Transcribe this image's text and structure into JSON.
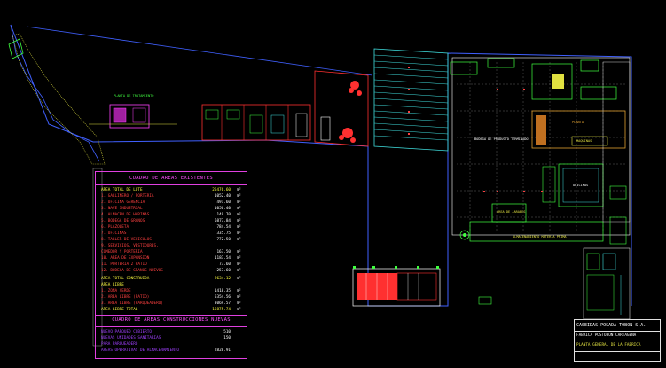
{
  "colors": {
    "background": "#000000",
    "table_border": "#e040e0",
    "table_title": "#ff50ff",
    "table_text": "#ff4040",
    "table_value": "#ffffff",
    "highlight": "#ffff40",
    "new_text": "#a040ff",
    "site_outline": "#4060ff",
    "parking_hatch": "#40e0e0",
    "walls": "#ff3030",
    "equipment": "#40ff40",
    "title_block": "#e0e0e0"
  },
  "existing_table": {
    "title": "CUADRO DE AREAS EXISTENTES",
    "total_label": "AREA TOTAL DE LOTE",
    "total_value": "25476.60",
    "unit": "m²",
    "rows": [
      {
        "label": "1.  GALLINERO / PORTERIA",
        "value": "1052.40"
      },
      {
        "label": "2.  OFICINA GERENCIA",
        "value": "491.60"
      },
      {
        "label": "3.  NAVE INDUSTRIAL",
        "value": "1056.40"
      },
      {
        "label": "4.  ALMACEN DE HARINAS",
        "value": "149.70"
      },
      {
        "label": "5.  BODEGA DE GRANOS",
        "value": "6877.84"
      },
      {
        "label": "6.  PLAZOLETA",
        "value": "784.54"
      },
      {
        "label": "7.  OFICINAS",
        "value": "335.75"
      },
      {
        "label": "8.  TALLER DE VEHICULOS",
        "value": "772.50"
      },
      {
        "label": "9.  SERVICIOS, VESTIDORES,",
        "value": ""
      },
      {
        "label": "    COMEDOR Y PORTERIA",
        "value": "163.50"
      },
      {
        "label": "10. AREA DE EXPANSION",
        "value": "1183.54"
      },
      {
        "label": "11. PORTERIA 2 PATIO",
        "value": "73.60"
      },
      {
        "label": "12. BODEGA DE GRANOS NUEVOS",
        "value": "257.60"
      }
    ],
    "built_label": "AREA TOTAL CONSTRUIDA",
    "built_value": "9634.12",
    "free_header": "AREA  LIBRE",
    "free_rows": [
      {
        "label": "1.  ZONA VERDE",
        "value": "1418.35"
      },
      {
        "label": "2.  AREA LIBRE (PATIO)",
        "value": "5354.56"
      },
      {
        "label": "3.  AREA LIBRE (PARQUEADERO)",
        "value": "3069.57"
      }
    ],
    "free_total_label": "AREA LIBRE TOTAL",
    "free_total_value": "15875.74"
  },
  "new_table": {
    "title": "CUADRO DE AREAS CONSTRUCCIONES NUEVAS",
    "rows": [
      {
        "label": "NUEVO PARQUEO CUBIERTO",
        "value": "510"
      },
      {
        "label": "NUEVAS UNIDADES SANITARIAS",
        "value": "150"
      },
      {
        "label": "PARA PARQUEADERO",
        "value": ""
      },
      {
        "label": "AREAS OPERATIVAS DE ALMACENAMIENTO",
        "value": "2828.91"
      }
    ]
  },
  "title_block": {
    "company": "CASEIDAS POSADA TOBON S.A.",
    "project": "FABRICA POSTOBON CARTAGENA",
    "drawing": "PLANTA GENERAL DE LA FABRICA"
  },
  "plan_labels": {
    "porteria": "PLANTA DE TRATAMIENTO",
    "oficinas": "OFICINAS",
    "bodega": "BODEGA DE PRODUCTO TERMINADO",
    "almacen": "ALMACENAMIENTO MATERIA PRIMA",
    "area_jarabes": "AREA DE JARABES",
    "planta": "PLANTA",
    "maquinas": "MAQUINAS"
  }
}
